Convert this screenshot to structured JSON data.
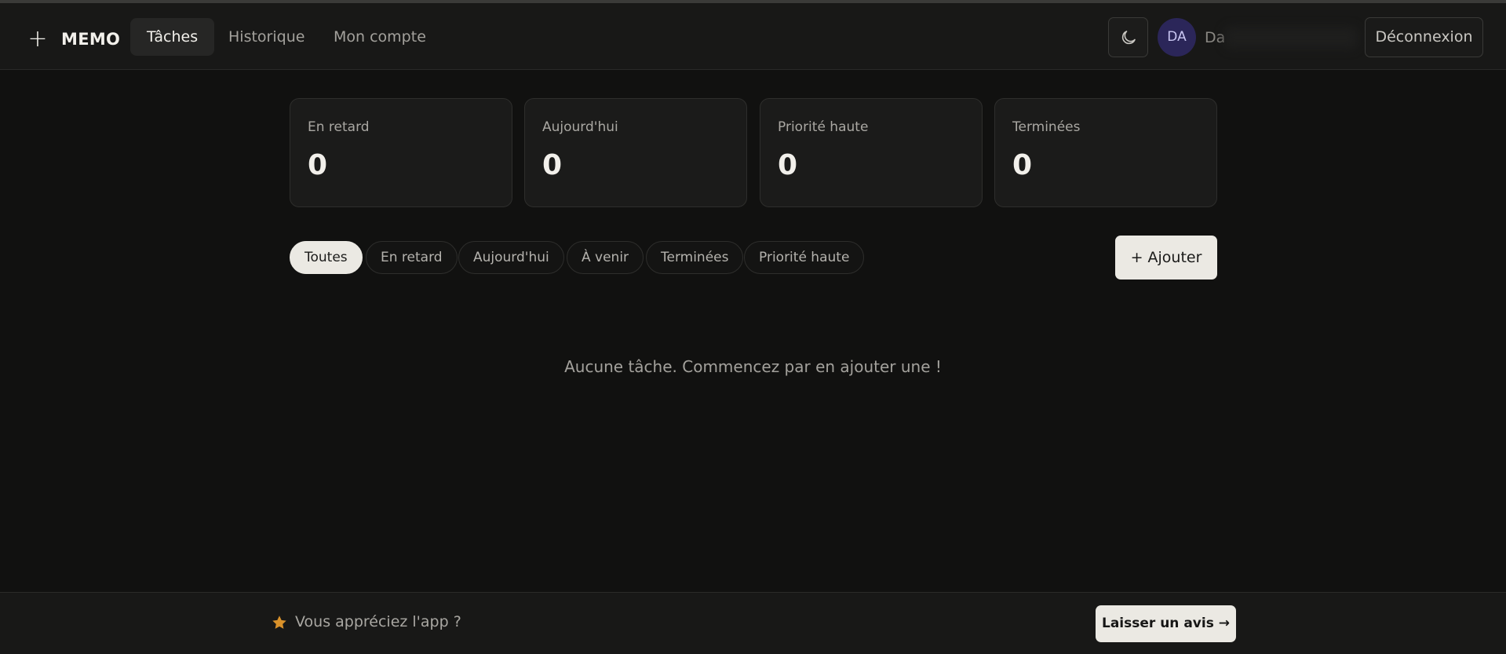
{
  "header": {
    "brand": "MEMO",
    "nav": [
      {
        "label": "Tâches",
        "active": true
      },
      {
        "label": "Historique",
        "active": false
      },
      {
        "label": "Mon compte",
        "active": false
      }
    ],
    "avatar_initials": "DA",
    "username": "Da",
    "logout_label": "Déconnexion"
  },
  "stats": [
    {
      "label": "En retard",
      "value": "0"
    },
    {
      "label": "Aujourd'hui",
      "value": "0"
    },
    {
      "label": "Priorité haute",
      "value": "0"
    },
    {
      "label": "Terminées",
      "value": "0"
    }
  ],
  "filters": [
    {
      "label": "Toutes",
      "active": true
    },
    {
      "label": "En retard",
      "active": false
    },
    {
      "label": "Aujourd'hui",
      "active": false
    },
    {
      "label": "À venir",
      "active": false
    },
    {
      "label": "Terminées",
      "active": false
    },
    {
      "label": "Priorité haute",
      "active": false
    }
  ],
  "add_label": "+ Ajouter",
  "empty_message": "Aucune tâche. Commencez par en ajouter une !",
  "footer": {
    "text": "Vous appréciez l'app ?",
    "review_label": "Laisser un avis →"
  },
  "colors": {
    "background": "#111110",
    "accent_light": "#ebe9e3",
    "avatar_bg": "#2b2659",
    "star": "#d9912a"
  }
}
